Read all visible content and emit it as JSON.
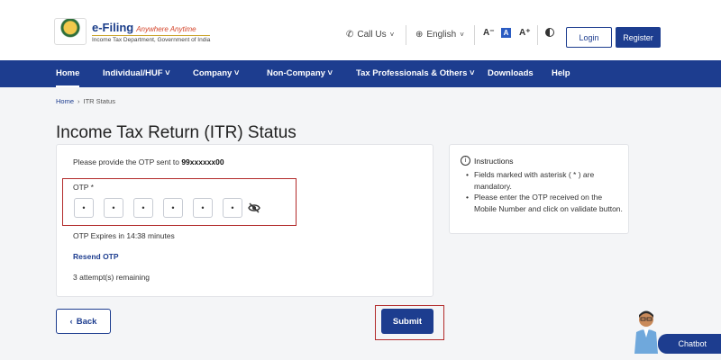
{
  "header": {
    "logo_title": "e-Filing",
    "logo_tagline": "Anywhere Anytime",
    "logo_subtitle": "Income Tax Department, Government of India",
    "call_us": "Call Us",
    "language": "English",
    "font_decrease": "A⁻",
    "font_normal": "A",
    "font_increase": "A⁺",
    "login": "Login",
    "register": "Register"
  },
  "nav": {
    "items": [
      {
        "label": "Home"
      },
      {
        "label": "Individual/HUF ˅"
      },
      {
        "label": "Company ˅"
      },
      {
        "label": "Non-Company ˅"
      },
      {
        "label": "Tax Professionals & Others ˅"
      },
      {
        "label": "Downloads"
      },
      {
        "label": "Help"
      }
    ]
  },
  "breadcrumb": {
    "home": "Home",
    "separator": "›",
    "current": "ITR Status"
  },
  "page_title": "Income Tax Return (ITR) Status",
  "otp": {
    "message_prefix": "Please provide the OTP sent to ",
    "phone": "99xxxxxx00",
    "label": "OTP *",
    "cells": [
      "•",
      "•",
      "•",
      "•",
      "•",
      "•"
    ],
    "expiry": "OTP Expires in 14:38 minutes",
    "resend": "Resend OTP",
    "attempts": "3 attempt(s) remaining"
  },
  "instructions": {
    "title": "Instructions",
    "items": [
      "Fields marked with asterisk ( * ) are mandatory.",
      "Please enter the OTP received on the Mobile Number and click on validate button."
    ]
  },
  "actions": {
    "back": "Back",
    "submit": "Submit"
  },
  "chatbot": {
    "label": "Chatbot"
  },
  "colors": {
    "brand": "#1d3d8f",
    "highlight": "#b22a2a"
  }
}
